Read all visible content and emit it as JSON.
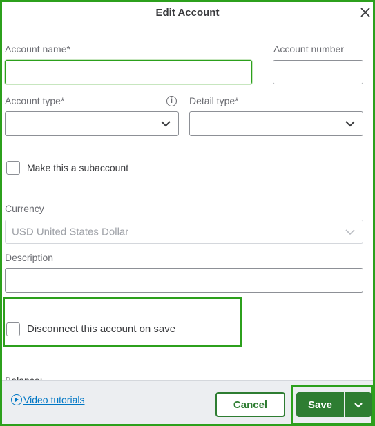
{
  "dialog": {
    "title": "Edit Account"
  },
  "form": {
    "account_name_label": "Account name*",
    "account_name_value": "",
    "account_number_label": "Account number",
    "account_number_value": "",
    "account_type_label": "Account type*",
    "account_type_value": "",
    "detail_type_label": "Detail type*",
    "detail_type_value": "",
    "subaccount_label": "Make this a subaccount",
    "currency_label": "Currency",
    "currency_value": "USD United States Dollar",
    "description_label": "Description",
    "description_value": "",
    "disconnect_label": "Disconnect this account on save",
    "balance_label": "Balance:"
  },
  "footer": {
    "video_link": "Video tutorials",
    "cancel_label": "Cancel",
    "save_label": "Save"
  },
  "colors": {
    "accent": "#2ca01c",
    "primary_button": "#2e7d32",
    "link": "#0077c5"
  },
  "icons": {
    "close": "close-icon",
    "info": "info-icon",
    "chevron": "chevron-down-icon",
    "play": "play-circle-icon"
  }
}
